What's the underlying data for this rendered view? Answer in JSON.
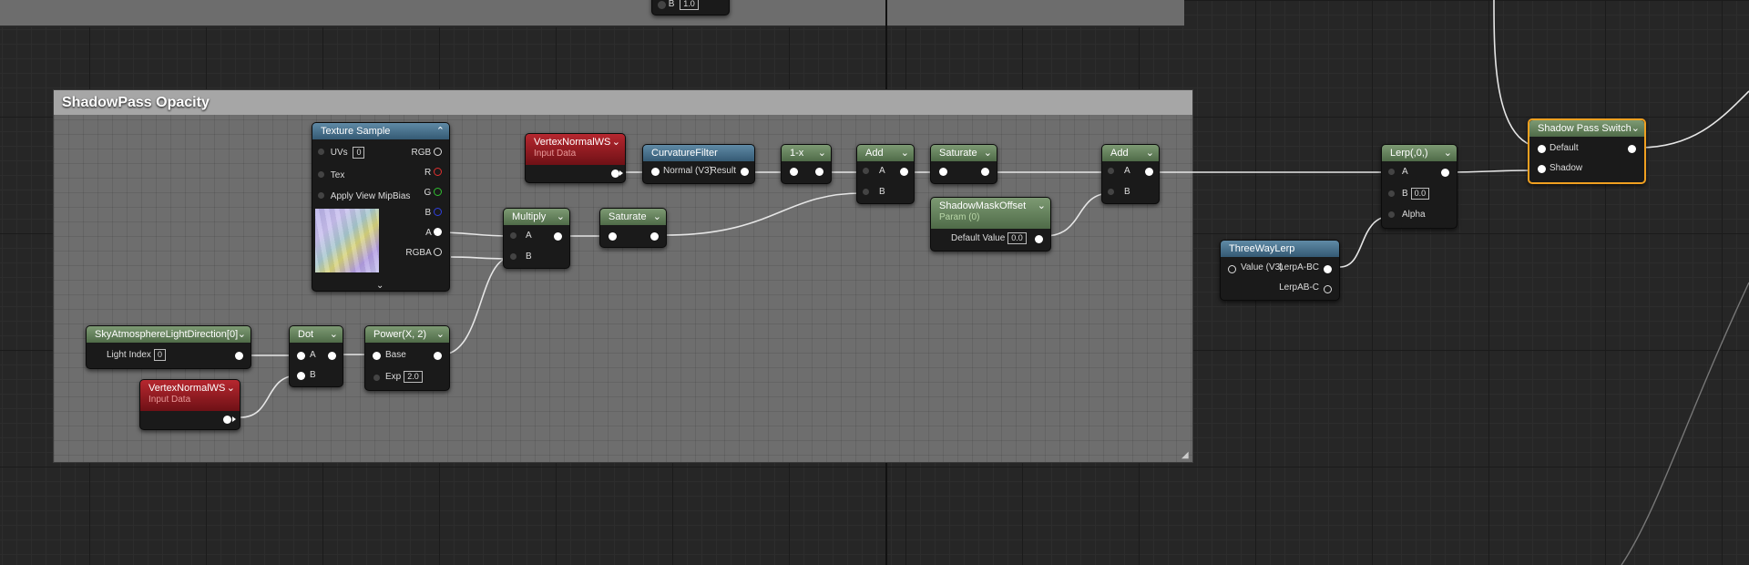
{
  "comment": {
    "title": "ShadowPass Opacity"
  },
  "top_partial": {
    "pin": "B",
    "value": "1.0"
  },
  "nodes": {
    "texture_sample": {
      "title": "Texture Sample",
      "uvs": "UVs",
      "uvs_value": "0",
      "tex": "Tex",
      "mip": "Apply View MipBias",
      "outputs": [
        "RGB",
        "R",
        "G",
        "B",
        "A",
        "RGBA"
      ]
    },
    "vertex_normal_1": {
      "title": "VertexNormalWS",
      "subtitle": "Input Data"
    },
    "curvature": {
      "title": "CurvatureFilter",
      "in": "Normal (V3)",
      "out": "Result"
    },
    "one_minus": {
      "title": "1-x"
    },
    "add_1": {
      "title": "Add",
      "a": "A",
      "b": "B"
    },
    "saturate_1": {
      "title": "Saturate"
    },
    "shadow_mask": {
      "title": "ShadowMaskOffset",
      "subtitle": "Param (0)",
      "label": "Default Value",
      "value": "0.0"
    },
    "add_2": {
      "title": "Add",
      "a": "A",
      "b": "B"
    },
    "multiply": {
      "title": "Multiply",
      "a": "A",
      "b": "B"
    },
    "saturate_2": {
      "title": "Saturate"
    },
    "sky_atmo": {
      "title": "SkyAtmosphereLightDirection[0]",
      "label": "Light Index",
      "value": "0"
    },
    "dot": {
      "title": "Dot",
      "a": "A",
      "b": "B"
    },
    "power": {
      "title": "Power(X, 2)",
      "base": "Base",
      "exp": "Exp",
      "exp_value": "2.0"
    },
    "vertex_normal_2": {
      "title": "VertexNormalWS",
      "subtitle": "Input Data"
    },
    "lerp": {
      "title": "Lerp(,0,)",
      "a": "A",
      "b": "B",
      "b_value": "0.0",
      "alpha": "Alpha"
    },
    "three_way": {
      "title": "ThreeWayLerp",
      "in": "Value (V3)",
      "out1": "LerpA-BC",
      "out2": "LerpAB-C"
    },
    "shadow_switch": {
      "title": "Shadow Pass Switch",
      "default": "Default",
      "shadow": "Shadow"
    }
  },
  "colors": {
    "selected": "#f0a020",
    "r_pin": "#e03030",
    "g_pin": "#30c030",
    "b_pin": "#3040e0"
  }
}
